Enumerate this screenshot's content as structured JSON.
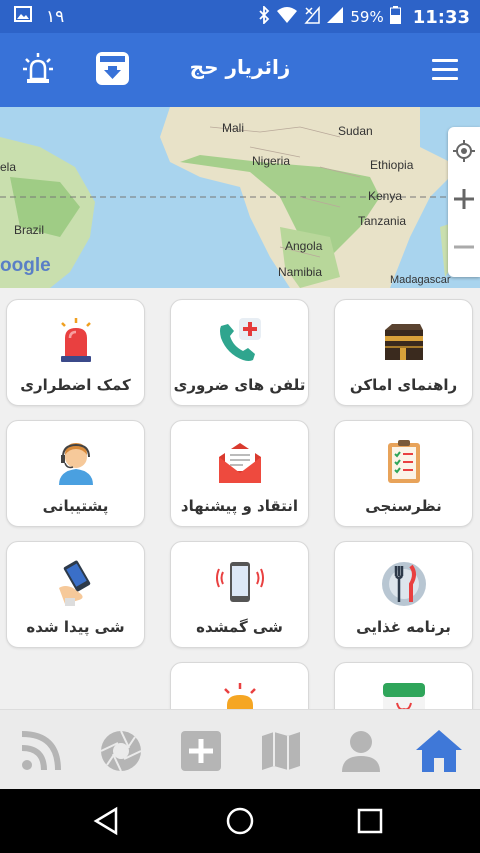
{
  "status_bar": {
    "notification_count": "۱۹",
    "battery": "59%",
    "time": "11:33"
  },
  "app_bar": {
    "title": "زائریار حج"
  },
  "map": {
    "labels": {
      "mali": "Mali",
      "sudan": "Sudan",
      "nigeria": "Nigeria",
      "ethiopia": "Ethiopia",
      "kenya": "Kenya",
      "tanzania": "Tanzania",
      "angola": "Angola",
      "brazil": "Brazil",
      "namibia": "Namibia",
      "madagascar": "Madagascar",
      "partial_left": "ela",
      "google": "oogle"
    }
  },
  "grid": {
    "items": [
      {
        "label": "راهنمای اماکن",
        "icon": "kaaba-icon"
      },
      {
        "label": "تلفن های ضروری",
        "icon": "phone-medical-icon"
      },
      {
        "label": "کمک اضطراری",
        "icon": "siren-icon"
      },
      {
        "label": "نظرسنجی",
        "icon": "clipboard-survey-icon"
      },
      {
        "label": "انتقاد و پیشنهاد",
        "icon": "envelope-icon"
      },
      {
        "label": "پشتیبانی",
        "icon": "support-agent-icon"
      },
      {
        "label": "برنامه غذایی",
        "icon": "plate-cutlery-icon"
      },
      {
        "label": "شی گمشده",
        "icon": "lost-phone-icon"
      },
      {
        "label": "شی پیدا شده",
        "icon": "found-item-icon"
      }
    ]
  },
  "bottom_nav": {
    "items": [
      "home-icon",
      "profile-icon",
      "map-icon",
      "add-icon",
      "camera-shutter-icon",
      "rss-icon"
    ],
    "active": "home-icon"
  },
  "colors": {
    "primary": "#3872d8",
    "status_bar": "#2d63c8",
    "nav_active": "#3f78d8",
    "nav_inactive": "#b5b5b5"
  }
}
